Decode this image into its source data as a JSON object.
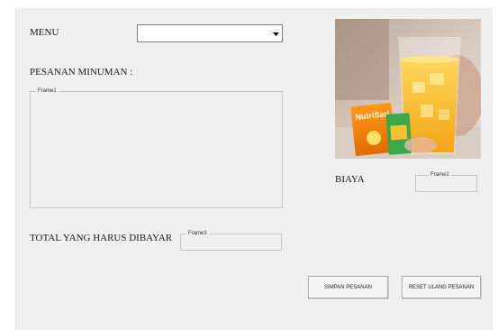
{
  "form": {
    "menu_label": "MENU",
    "menu_value": "",
    "pesanan_label": "PESANAN MINUMAN :",
    "frame1_caption": "Frame1",
    "total_label": "TOTAL YANG HARUS DIBAYAR",
    "frame3_caption": "Frame3",
    "biaya_label": "BIAYA",
    "frame2_caption": "Frame2",
    "simpan_button": "SIMPAN PESANAN",
    "reset_button": "RESET ULANG PESANAN",
    "photo_brand": "NutriSari"
  }
}
